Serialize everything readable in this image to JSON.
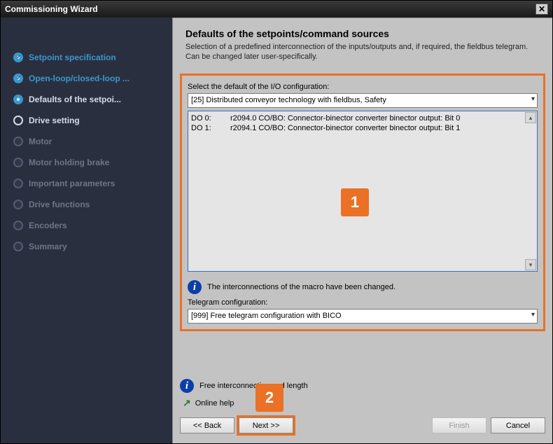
{
  "window": {
    "title": "Commissioning Wizard"
  },
  "steps": {
    "s0": "Setpoint specification",
    "s1": "Open-loop/closed-loop ...",
    "s2": "Defaults of the setpoi...",
    "s3": "Drive setting",
    "s4": "Motor",
    "s5": "Motor holding brake",
    "s6": "Important parameters",
    "s7": "Drive functions",
    "s8": "Encoders",
    "s9": "Summary"
  },
  "header": {
    "title": "Defaults of the setpoints/command sources",
    "desc": "Selection of a predefined interconnection of the inputs/outputs and, if required, the fieldbus telegram. Can be changed later user-specifically."
  },
  "panel": {
    "io_label": "Select the default of the I/O configuration:",
    "io_value": "[25] Distributed conveyor technology with fieldbus, Safety",
    "rows": [
      {
        "c0": "DO 0:",
        "c1": "r2094.0 CO/BO: Connector-binector converter binector output: Bit 0"
      },
      {
        "c0": "DO 1:",
        "c1": "r2094.1 CO/BO: Connector-binector converter binector output: Bit 1"
      }
    ],
    "info1": "The interconnections of the macro have been changed.",
    "tele_label": "Telegram configuration:",
    "tele_value": "[999] Free telegram configuration with BICO"
  },
  "footer": {
    "info2": "Free interconnection and length",
    "help": "Online help",
    "back": "<< Back",
    "next": "Next >>",
    "finish": "Finish",
    "cancel": "Cancel"
  },
  "callouts": {
    "c1": "1",
    "c2": "2"
  }
}
